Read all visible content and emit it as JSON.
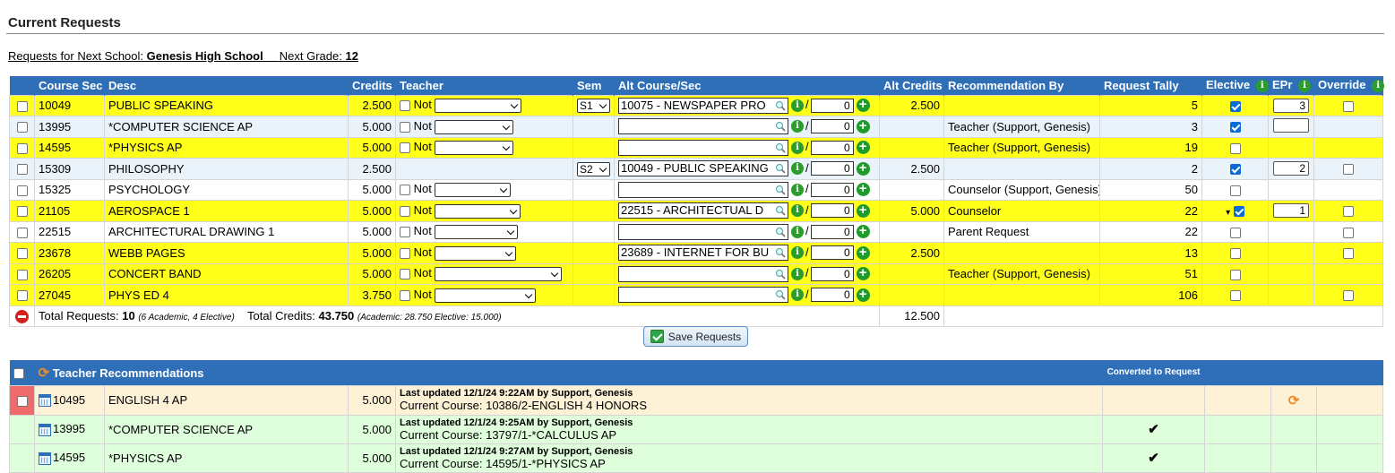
{
  "header": {
    "title": "Current Requests",
    "next_school_label": "Requests for Next School:",
    "next_school": "Genesis High School",
    "next_grade_label": "Next Grade:",
    "next_grade": "12"
  },
  "columns": {
    "course_sec": "Course Sec",
    "desc": "Desc",
    "credits": "Credits",
    "teacher": "Teacher",
    "sem": "Sem",
    "alt_course": "Alt Course/Sec",
    "alt_credits": "Alt Credits",
    "recommendation_by": "Recommendation By",
    "request_tally": "Request Tally",
    "elective": "Elective",
    "epr": "EPr",
    "override": "Override"
  },
  "not_label": "Not",
  "rows": [
    {
      "course": "10049",
      "desc": "PUBLIC SPEAKING",
      "credits": "2.500",
      "sem": "S1",
      "alt": "10075 - NEWSPAPER PRO",
      "alt_num": "0",
      "alt_credits": "2.500",
      "rec_by": "",
      "tally": "5",
      "elective": true,
      "epr": "3"
    },
    {
      "course": "13995",
      "desc": "*COMPUTER SCIENCE AP",
      "credits": "5.000",
      "sem": "",
      "alt": "",
      "alt_num": "0",
      "alt_credits": "",
      "rec_by": "Teacher (Support, Genesis)",
      "tally": "3",
      "elective": true,
      "epr": ""
    },
    {
      "course": "14595",
      "desc": "*PHYSICS AP",
      "credits": "5.000",
      "sem": "",
      "alt": "",
      "alt_num": "0",
      "alt_credits": "",
      "rec_by": "Teacher (Support, Genesis)",
      "tally": "19",
      "elective": false,
      "epr": ""
    },
    {
      "course": "15309",
      "desc": "PHILOSOPHY",
      "credits": "2.500",
      "sem": "S2",
      "alt": "10049 - PUBLIC SPEAKING",
      "alt_num": "0",
      "alt_credits": "2.500",
      "rec_by": "",
      "tally": "2",
      "elective": true,
      "epr": "2"
    },
    {
      "course": "15325",
      "desc": "PSYCHOLOGY",
      "credits": "5.000",
      "sem": "",
      "alt": "",
      "alt_num": "0",
      "alt_credits": "",
      "rec_by": "Counselor (Support, Genesis)",
      "tally": "50",
      "elective": false,
      "epr": ""
    },
    {
      "course": "21105",
      "desc": "AEROSPACE 1",
      "credits": "5.000",
      "sem": "",
      "alt": "22515 - ARCHITECTUAL D",
      "alt_num": "0",
      "alt_credits": "5.000",
      "rec_by": "Counselor",
      "tally": "22",
      "elective": true,
      "epr": "1"
    },
    {
      "course": "22515",
      "desc": "ARCHITECTURAL DRAWING 1",
      "credits": "5.000",
      "sem": "",
      "alt": "",
      "alt_num": "0",
      "alt_credits": "",
      "rec_by": "Parent Request",
      "tally": "22",
      "elective": false,
      "epr": ""
    },
    {
      "course": "23678",
      "desc": "WEBB PAGES",
      "credits": "5.000",
      "sem": "",
      "alt": "23689 - INTERNET FOR BU",
      "alt_num": "0",
      "alt_credits": "2.500",
      "rec_by": "",
      "tally": "13",
      "elective": false,
      "epr": ""
    },
    {
      "course": "26205",
      "desc": "CONCERT BAND",
      "credits": "5.000",
      "sem": "",
      "alt": "",
      "alt_num": "0",
      "alt_credits": "",
      "rec_by": "Teacher (Support, Genesis)",
      "tally": "51",
      "elective": false,
      "epr": ""
    },
    {
      "course": "27045",
      "desc": "PHYS ED 4",
      "credits": "3.750",
      "sem": "",
      "alt": "",
      "alt_num": "0",
      "alt_credits": "",
      "rec_by": "",
      "tally": "106",
      "elective": false,
      "epr": ""
    }
  ],
  "totals": {
    "requests_label": "Total Requests:",
    "requests": "10",
    "requests_detail": "(6 Academic, 4 Elective)",
    "credits_label": "Total Credits:",
    "credits": "43.750",
    "credits_detail": "(Academic: 28.750 Elective: 15.000)",
    "alt_credits": "12.500"
  },
  "save_label": "Save Requests",
  "teacher_recs": {
    "title": "Teacher Recommendations",
    "converted_label": "Converted to Request",
    "rows": [
      {
        "course": "10495",
        "desc": "ENGLISH 4 AP",
        "credits": "5.000",
        "updated": "Last updated 12/1/24 9:22AM by Support, Genesis",
        "current": "Current Course: 10386/2-ENGLISH 4 HONORS",
        "converted": ""
      },
      {
        "course": "13995",
        "desc": "*COMPUTER SCIENCE AP",
        "credits": "5.000",
        "updated": "Last updated 12/1/24 9:25AM by Support, Genesis",
        "current": "Current Course: 13797/1-*CALCULUS AP",
        "converted": "✔"
      },
      {
        "course": "14595",
        "desc": "*PHYSICS AP",
        "credits": "5.000",
        "updated": "Last updated 12/1/24 9:27AM by Support, Genesis",
        "current": "Current Course: 14595/1-*PHYSICS AP",
        "converted": "✔"
      }
    ]
  }
}
